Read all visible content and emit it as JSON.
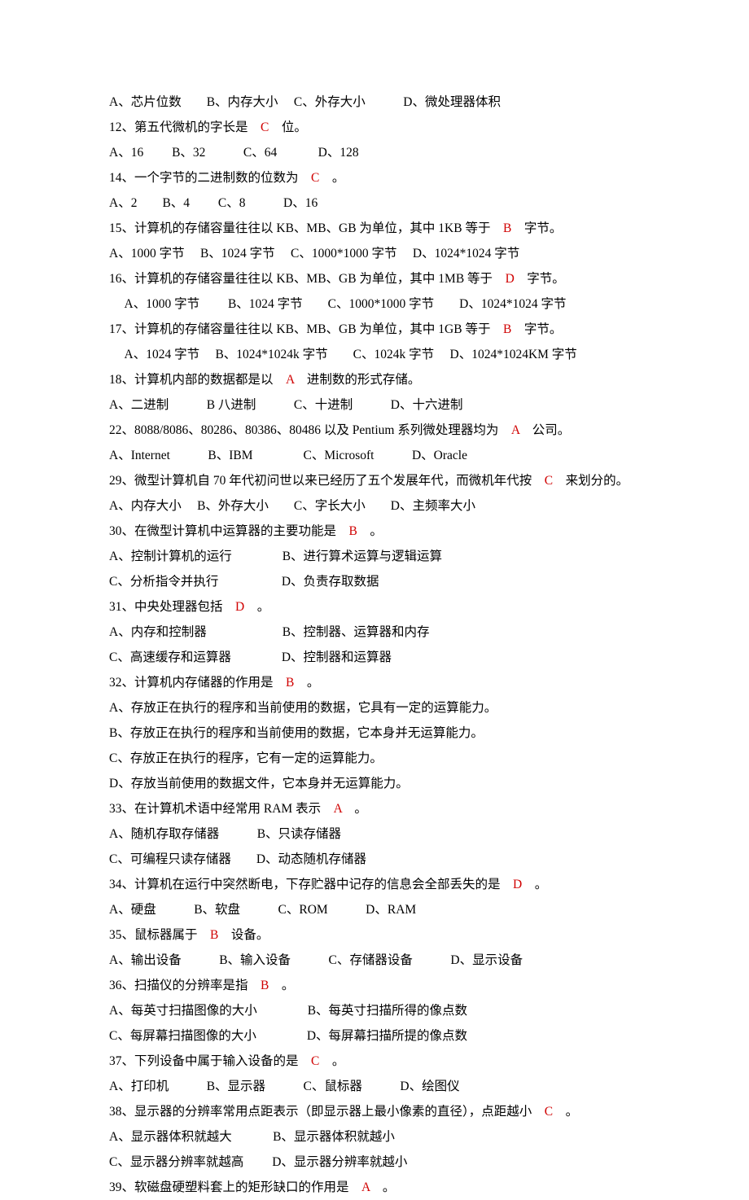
{
  "lines": [
    {
      "segs": [
        [
          "A、芯片位数　　B、内存大小　 C、外存大小　　　D、微处理器体积",
          0
        ]
      ]
    },
    {
      "segs": [
        [
          "12、第五代微机的字长是　",
          0
        ],
        [
          "C",
          1
        ],
        [
          "　位。",
          0
        ]
      ]
    },
    {
      "segs": [
        [
          "A、16　　 B、32　　　C、64　　　 D、128",
          0
        ]
      ]
    },
    {
      "segs": [
        [
          "14、一个字节的二进制数的位数为　",
          0
        ],
        [
          "C",
          1
        ],
        [
          "　。",
          0
        ]
      ]
    },
    {
      "segs": [
        [
          "A、2　　B、4　　 C、8　　　D、16",
          0
        ]
      ]
    },
    {
      "segs": [
        [
          "15、计算机的存储容量往往以 KB、MB、GB 为单位，其中 1KB 等于　",
          0
        ],
        [
          "B",
          1
        ],
        [
          "　字节。",
          0
        ]
      ]
    },
    {
      "segs": [
        [
          "A、1000 字节　 B、1024 字节　 C、1000*1000 字节　 D、1024*1024 字节",
          0
        ]
      ]
    },
    {
      "segs": [
        [
          "16、计算机的存储容量往往以 KB、MB、GB 为单位，其中 1MB 等于　",
          0
        ],
        [
          "D",
          1
        ],
        [
          "　字节。",
          0
        ]
      ]
    },
    {
      "segs": [
        [
          "　 A、1000 字节　　 B、1024 字节　　C、1000*1000 字节　　D、1024*1024 字节",
          0
        ]
      ]
    },
    {
      "segs": [
        [
          "17、计算机的存储容量往往以 KB、MB、GB 为单位，其中 1GB 等于　",
          0
        ],
        [
          "B",
          1
        ],
        [
          "　字节。",
          0
        ]
      ]
    },
    {
      "segs": [
        [
          "　 A、1024 字节　 B、1024*1024k 字节　　C、1024k 字节　 D、1024*1024KM 字节",
          0
        ]
      ]
    },
    {
      "segs": [
        [
          "18、计算机内部的数据都是以　",
          0
        ],
        [
          "A",
          1
        ],
        [
          "　进制数的形式存储。",
          0
        ]
      ]
    },
    {
      "segs": [
        [
          "A、二进制　　　B 八进制　　　C、十进制　　　D、十六进制",
          0
        ]
      ]
    },
    {
      "segs": [
        [
          "22、8088/8086、80286、80386、80486 以及 Pentium 系列微处理器均为　",
          0
        ],
        [
          "A",
          1
        ],
        [
          "　公司。",
          0
        ]
      ]
    },
    {
      "segs": [
        [
          "A、Internet　　　B、IBM　　　　C、Microsoft　　　D、Oracle",
          0
        ]
      ]
    },
    {
      "segs": [
        [
          "29、微型计算机自 70 年代初问世以来已经历了五个发展年代，而微机年代按　",
          0
        ],
        [
          "C",
          1
        ],
        [
          "　来划分的。",
          0
        ]
      ]
    },
    {
      "segs": [
        [
          "A、内存大小　 B、外存大小　　C、字长大小　　D、主频率大小",
          0
        ]
      ]
    },
    {
      "segs": [
        [
          "30、在微型计算机中运算器的主要功能是　",
          0
        ],
        [
          "B",
          1
        ],
        [
          "　。",
          0
        ]
      ]
    },
    {
      "segs": [
        [
          "A、控制计算机的运行　　　　B、进行算术运算与逻辑运算",
          0
        ]
      ]
    },
    {
      "segs": [
        [
          "C、分析指令并执行　　　　　D、负责存取数据",
          0
        ]
      ]
    },
    {
      "segs": [
        [
          "31、中央处理器包括　",
          0
        ],
        [
          "D",
          1
        ],
        [
          "　。",
          0
        ]
      ]
    },
    {
      "segs": [
        [
          "A、内存和控制器　　　　　　B、控制器、运算器和内存",
          0
        ]
      ]
    },
    {
      "segs": [
        [
          "C、高速缓存和运算器　　　　D、控制器和运算器",
          0
        ]
      ]
    },
    {
      "segs": [
        [
          "32、计算机内存储器的作用是　",
          0
        ],
        [
          "B",
          1
        ],
        [
          "　。",
          0
        ]
      ]
    },
    {
      "segs": [
        [
          "A、存放正在执行的程序和当前使用的数据，它具有一定的运算能力。",
          0
        ]
      ]
    },
    {
      "segs": [
        [
          "B、存放正在执行的程序和当前使用的数据，它本身并无运算能力。",
          0
        ]
      ]
    },
    {
      "segs": [
        [
          "C、存放正在执行的程序，它有一定的运算能力。",
          0
        ]
      ]
    },
    {
      "segs": [
        [
          "D、存放当前使用的数据文件，它本身并无运算能力。",
          0
        ]
      ]
    },
    {
      "segs": [
        [
          "33、在计算机术语中经常用 RAM 表示　",
          0
        ],
        [
          "A",
          1
        ],
        [
          "　。",
          0
        ]
      ]
    },
    {
      "segs": [
        [
          "A、随机存取存储器　　　B、只读存储器",
          0
        ]
      ]
    },
    {
      "segs": [
        [
          "C、可编程只读存储器　　D、动态随机存储器",
          0
        ]
      ]
    },
    {
      "segs": [
        [
          "34、计算机在运行中突然断电，下存贮器中记存的信息会全部丢失的是　",
          0
        ],
        [
          "D",
          1
        ],
        [
          "　。",
          0
        ]
      ]
    },
    {
      "segs": [
        [
          "A、硬盘　　　B、软盘　　　C、ROM　　　D、RAM",
          0
        ]
      ]
    },
    {
      "segs": [
        [
          "35、鼠标器属于　",
          0
        ],
        [
          "B",
          1
        ],
        [
          "　设备。",
          0
        ]
      ]
    },
    {
      "segs": [
        [
          "A、输出设备　　　B、输入设备　　　C、存储器设备　　　D、显示设备",
          0
        ]
      ]
    },
    {
      "segs": [
        [
          "36、扫描仪的分辨率是指　",
          0
        ],
        [
          "B",
          1
        ],
        [
          "　。",
          0
        ]
      ]
    },
    {
      "segs": [
        [
          "A、每英寸扫描图像的大小　　　　B、每英寸扫描所得的像点数",
          0
        ]
      ]
    },
    {
      "segs": [
        [
          "C、每屏幕扫描图像的大小　　　　D、每屏幕扫描所提的像点数",
          0
        ]
      ]
    },
    {
      "segs": [
        [
          "37、下列设备中属于输入设备的是　",
          0
        ],
        [
          "C",
          1
        ],
        [
          "　。",
          0
        ]
      ]
    },
    {
      "segs": [
        [
          "A、打印机　　　B、显示器　　　C、鼠标器　　　D、绘图仪",
          0
        ]
      ]
    },
    {
      "segs": [
        [
          "38、显示器的分辨率常用点距表示（即显示器上最小像素的直径），点距越小　",
          0
        ],
        [
          "C",
          1
        ],
        [
          "　。",
          0
        ]
      ]
    },
    {
      "segs": [
        [
          "A、显示器体积就越大　　　 B、显示器体积就越小",
          0
        ]
      ]
    },
    {
      "segs": [
        [
          "C、显示器分辨率就越高　　 D、显示器分辨率就越小",
          0
        ]
      ]
    },
    {
      "segs": [
        [
          "39、软磁盘硬塑料套上的矩形缺口的作用是　",
          0
        ],
        [
          "A",
          1
        ],
        [
          "　。",
          0
        ]
      ]
    }
  ]
}
